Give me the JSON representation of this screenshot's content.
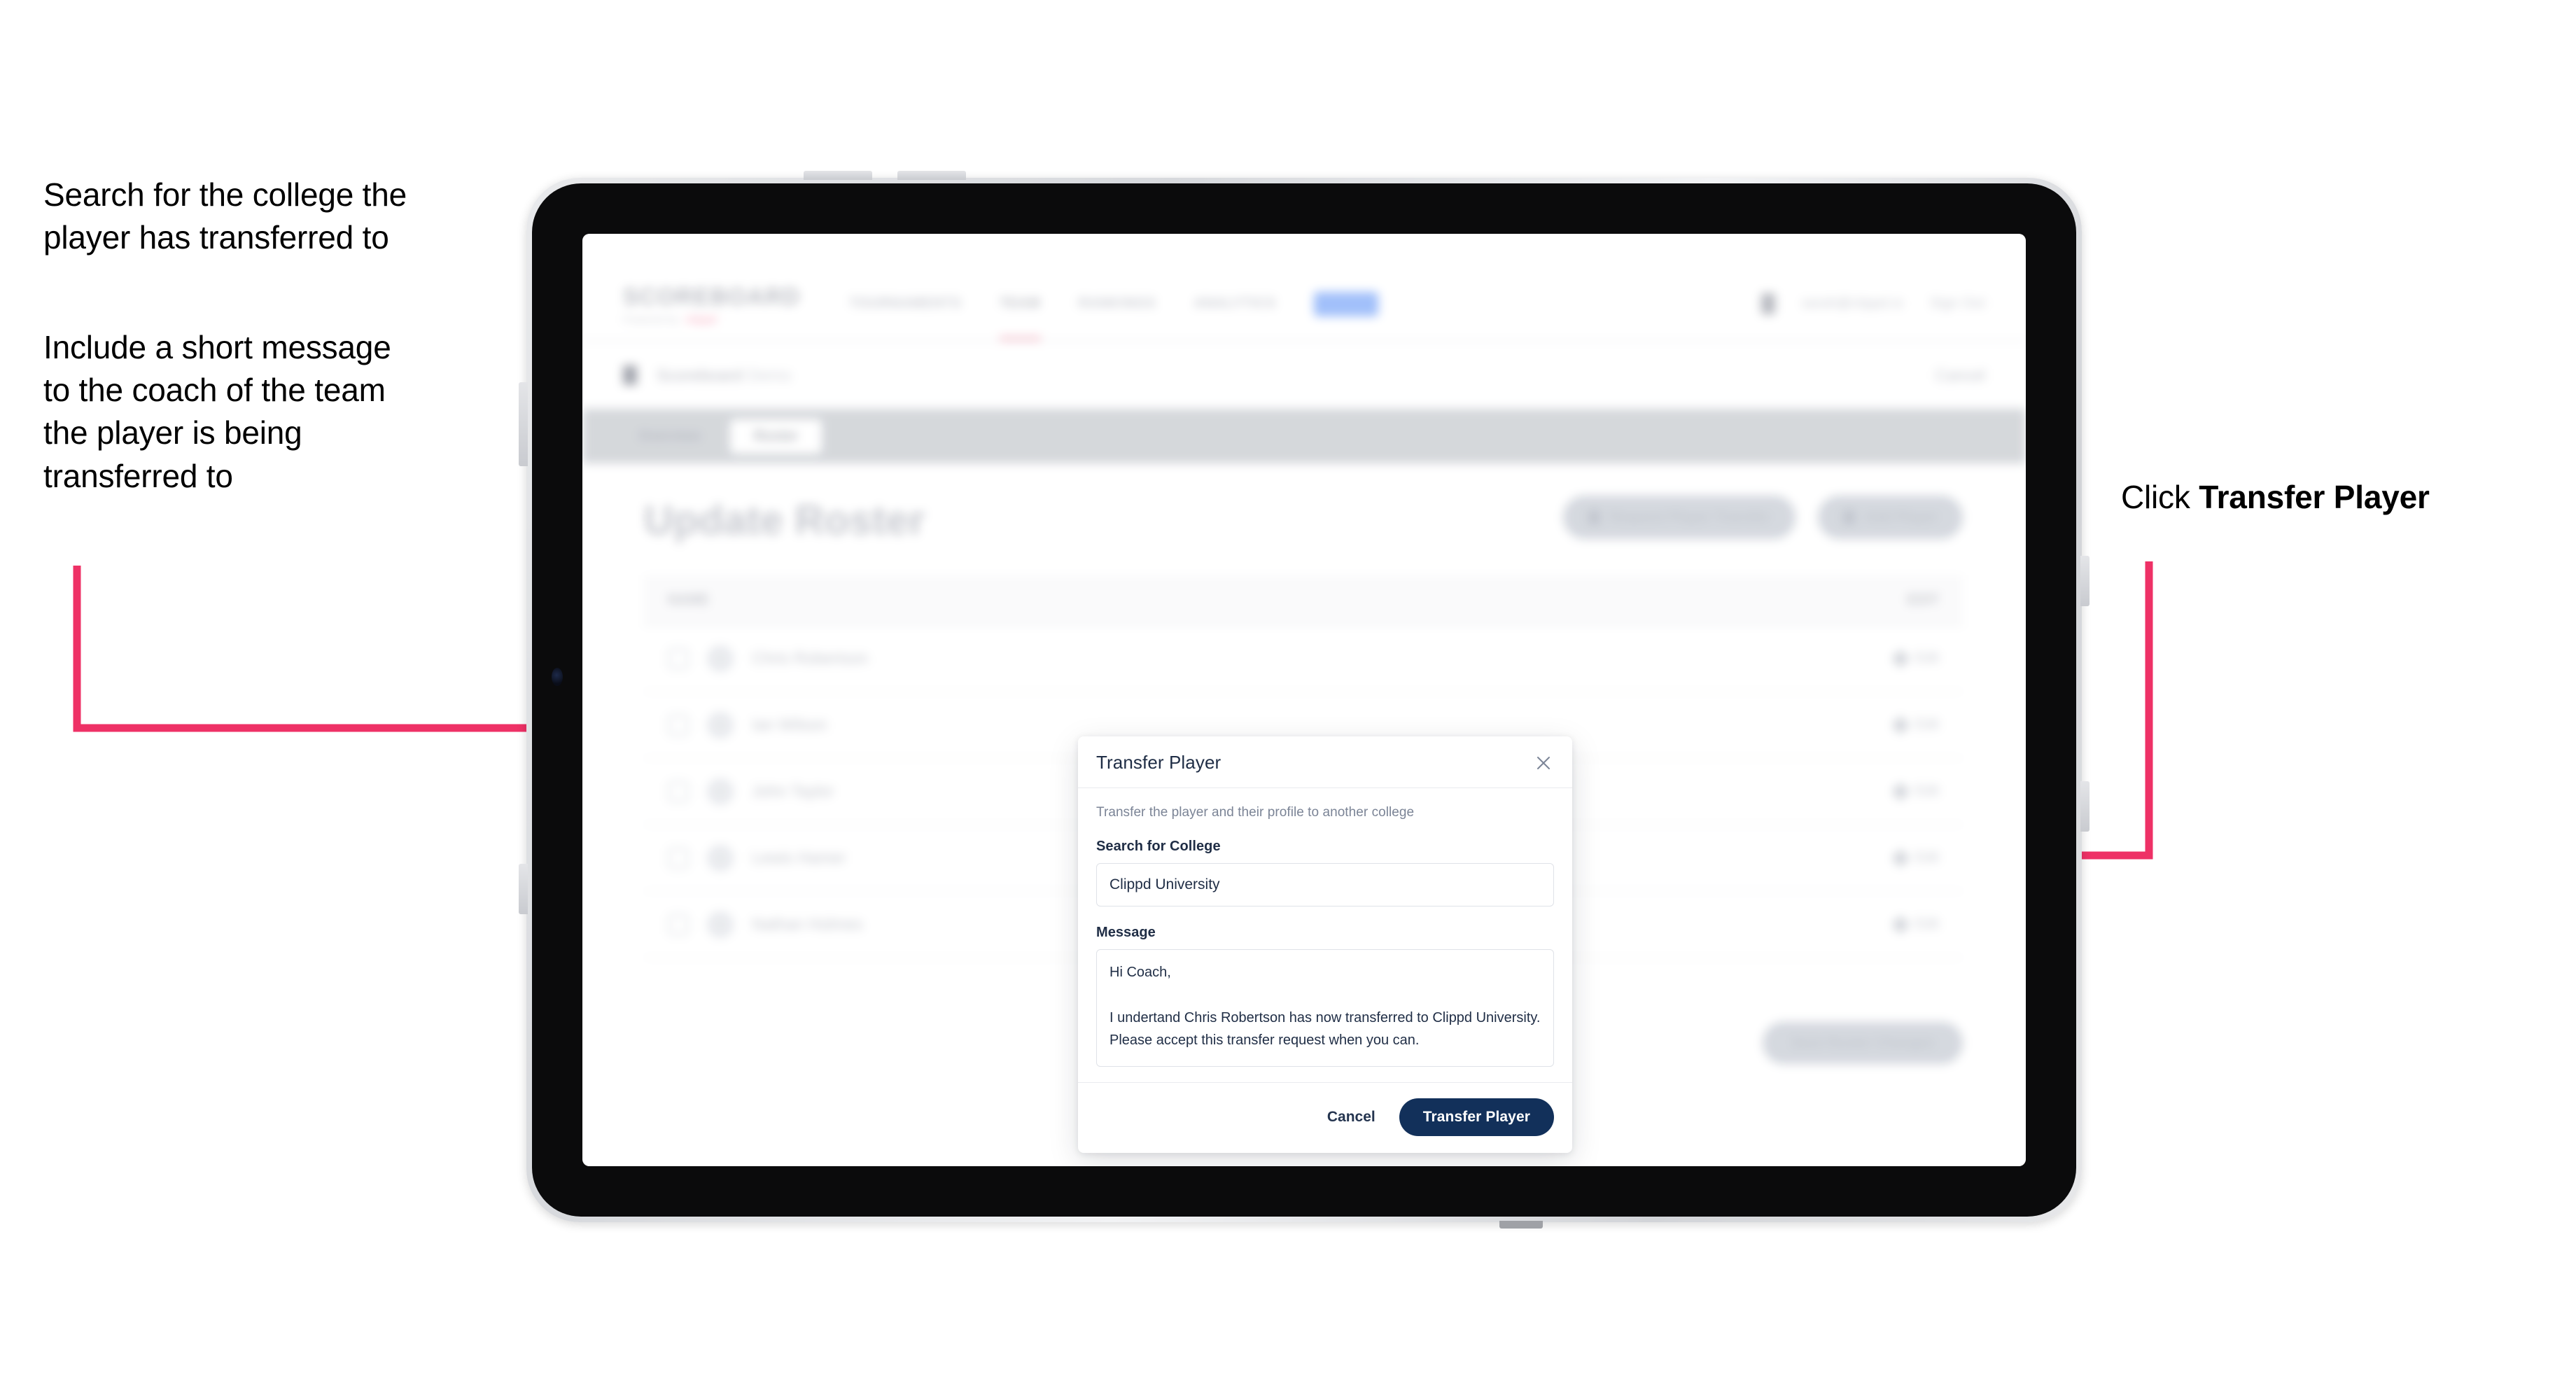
{
  "annotations": {
    "left_top": "Search for the college the\nplayer has transferred to",
    "left_bottom": "Include a short message\nto the coach of the team\nthe player is being\ntransferred to",
    "right_prefix": "Click ",
    "right_bold": "Transfer Player",
    "arrow_color": "#ee3166"
  },
  "app": {
    "logo": {
      "main": "SCOREBOARD",
      "sub": "Powered by",
      "brand": "clippd"
    },
    "nav_items": [
      {
        "label": "TOURNAMENTS",
        "active": false
      },
      {
        "label": "TEAM",
        "active": true
      },
      {
        "label": "RANKINGS",
        "active": false
      },
      {
        "label": "ANALYTICS",
        "active": false
      }
    ],
    "nav_badge": "BETA",
    "nav_right": [
      "sarah@clippd.io",
      "Sign Out"
    ],
    "breadcrumb": {
      "text": "Scoreboard",
      "muted": "Demo",
      "right": "Cancel"
    },
    "tabs": [
      {
        "label": "Overview",
        "active": false
      },
      {
        "label": "Roster",
        "active": true
      }
    ],
    "page_title": "Update Roster",
    "header_actions": [
      {
        "label": "Request Player Transfer",
        "icon": "transfer-icon"
      },
      {
        "label": "Add Player",
        "icon": "plus-icon"
      }
    ],
    "table": {
      "columns": [
        "NAME",
        "EDIT"
      ],
      "rows": [
        {
          "name": "Chris Robertson",
          "edit": "Edit"
        },
        {
          "name": "Ian Wilson",
          "edit": "Edit"
        },
        {
          "name": "John Taylor",
          "edit": "Edit"
        },
        {
          "name": "Lewis Hamer",
          "edit": "Edit"
        },
        {
          "name": "Nathan Holmes",
          "edit": "Edit"
        }
      ]
    },
    "footer_button": "Save Roster Changes"
  },
  "modal": {
    "title": "Transfer Player",
    "close_icon": "close-icon",
    "subtitle": "Transfer the player and their profile to another college",
    "college_label": "Search for College",
    "college_value": "Clippd University",
    "college_placeholder": "Search for College",
    "message_label": "Message",
    "message_value": "Hi Coach,\n\nI undertand Chris Robertson has now transferred to Clippd University.\nPlease accept this transfer request when you can.",
    "cancel_label": "Cancel",
    "submit_label": "Transfer Player",
    "submit_color": "#12305a"
  }
}
